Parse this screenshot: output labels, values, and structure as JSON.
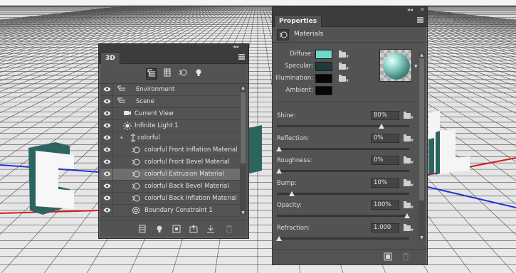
{
  "panel_3d": {
    "tab_label": "3D",
    "filter_buttons": [
      "scene-filter",
      "mesh-filter",
      "material-filter",
      "light-filter"
    ],
    "rows": [
      {
        "label": "Environment",
        "icon": "environment-icon",
        "depth": 0,
        "expander": ""
      },
      {
        "label": "Scene",
        "icon": "scene-icon",
        "depth": 0,
        "expander": ""
      },
      {
        "label": "Current View",
        "icon": "camera-icon",
        "depth": 1,
        "expander": ""
      },
      {
        "label": "Infinite Light 1",
        "icon": "light-icon",
        "depth": 1,
        "expander": ""
      },
      {
        "label": "colorful",
        "icon": "mesh-icon",
        "depth": 1,
        "expander": "▾"
      },
      {
        "label": "colorful Front Inflation Material",
        "icon": "material-icon",
        "depth": 2,
        "expander": ""
      },
      {
        "label": "colorful Front Bevel Material",
        "icon": "material-icon",
        "depth": 2,
        "expander": ""
      },
      {
        "label": "colorful Extrusion Material",
        "icon": "material-icon",
        "depth": 2,
        "expander": "",
        "selected": true
      },
      {
        "label": "colorful Back Bevel Material",
        "icon": "material-icon",
        "depth": 2,
        "expander": ""
      },
      {
        "label": "colorful Back Inflation Material",
        "icon": "material-icon",
        "depth": 2,
        "expander": ""
      },
      {
        "label": "Boundary Constraint 1",
        "icon": "constraint-icon",
        "depth": 2,
        "expander": ""
      }
    ],
    "bottom_buttons": [
      "render-icon",
      "add-light-icon",
      "new-object-icon",
      "export-icon",
      "move-to-ground-icon",
      "delete-icon"
    ]
  },
  "panel_props": {
    "tab_label": "Properties",
    "section_title": "Materials",
    "colors": [
      {
        "label": "Diffuse:",
        "color": "#70d8cc",
        "folder": true
      },
      {
        "label": "Specular:",
        "color": "#1f3a38",
        "folder": true
      },
      {
        "label": "Illumination:",
        "color": "#060606",
        "folder": true
      },
      {
        "label": "Ambient:",
        "color": "#060606",
        "folder": false
      }
    ],
    "sliders": [
      {
        "label": "Shine:",
        "value": "80%",
        "fraction": 0.8
      },
      {
        "label": "Reflection:",
        "value": "0%",
        "fraction": 0.0
      },
      {
        "label": "Roughness:",
        "value": "0%",
        "fraction": 0.0
      },
      {
        "label": "Bump:",
        "value": "10%",
        "fraction": 0.1
      },
      {
        "label": "Opacity:",
        "value": "100%",
        "fraction": 1.0
      },
      {
        "label": "Refraction:",
        "value": "1.000",
        "fraction": 0.0
      }
    ],
    "bottom_buttons": [
      "render-preview-icon",
      "delete-icon"
    ]
  },
  "theme": {
    "panel_bg": "#535353",
    "header_bg": "#3c3c3c",
    "selected_row": "#6e6e6e",
    "accent_teal": "#70d8cc"
  }
}
